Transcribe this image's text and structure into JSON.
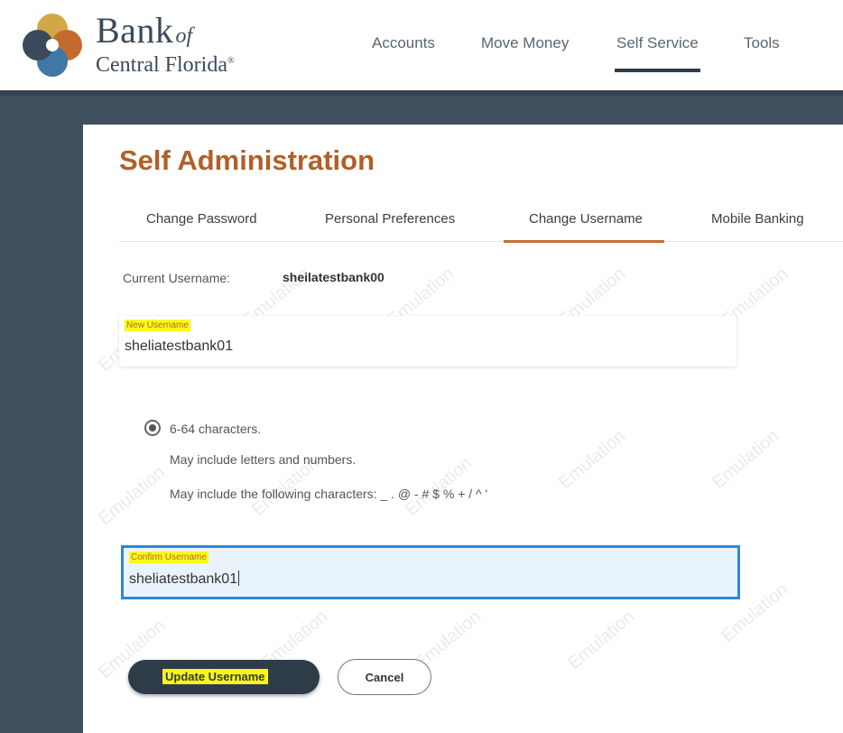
{
  "brand": {
    "name_main": "Bank",
    "name_of": "of",
    "name_sub": "Central Florida",
    "reg": "®",
    "colors": {
      "gold": "#d1a845",
      "orange": "#c46a2f",
      "blue": "#3f77a6",
      "slate": "#3b4a5a"
    }
  },
  "topnav": {
    "items": [
      {
        "label": "Accounts"
      },
      {
        "label": "Move Money"
      },
      {
        "label": "Self Service"
      },
      {
        "label": "Tools"
      }
    ],
    "active": "Self Service"
  },
  "page": {
    "title": "Self Administration",
    "tabs": [
      {
        "label": "Change Password"
      },
      {
        "label": "Personal Preferences"
      },
      {
        "label": "Change Username"
      },
      {
        "label": "Mobile Banking"
      }
    ],
    "active_tab": "Change Username"
  },
  "current": {
    "label": "Current Username:",
    "value": "sheilatestbank00"
  },
  "new_username": {
    "label": "New Username",
    "value": "sheliatestbank01"
  },
  "rules": {
    "length": "6-64 characters.",
    "letters": "May include letters and numbers.",
    "specials": "May include the following characters: _ . @ - # $ % + / ^ '"
  },
  "confirm_username": {
    "label": "Confirm Username",
    "value": "sheliatestbank01"
  },
  "buttons": {
    "update": "Update Username",
    "cancel": "Cancel"
  },
  "watermark": "Emulation",
  "colors": {
    "accent": "#c47034",
    "title": "#b25f28",
    "band": "#3f4f5e",
    "focus": "#2f86dd",
    "highlight": "#f6f61d",
    "primary_button": "#2e3c48"
  }
}
